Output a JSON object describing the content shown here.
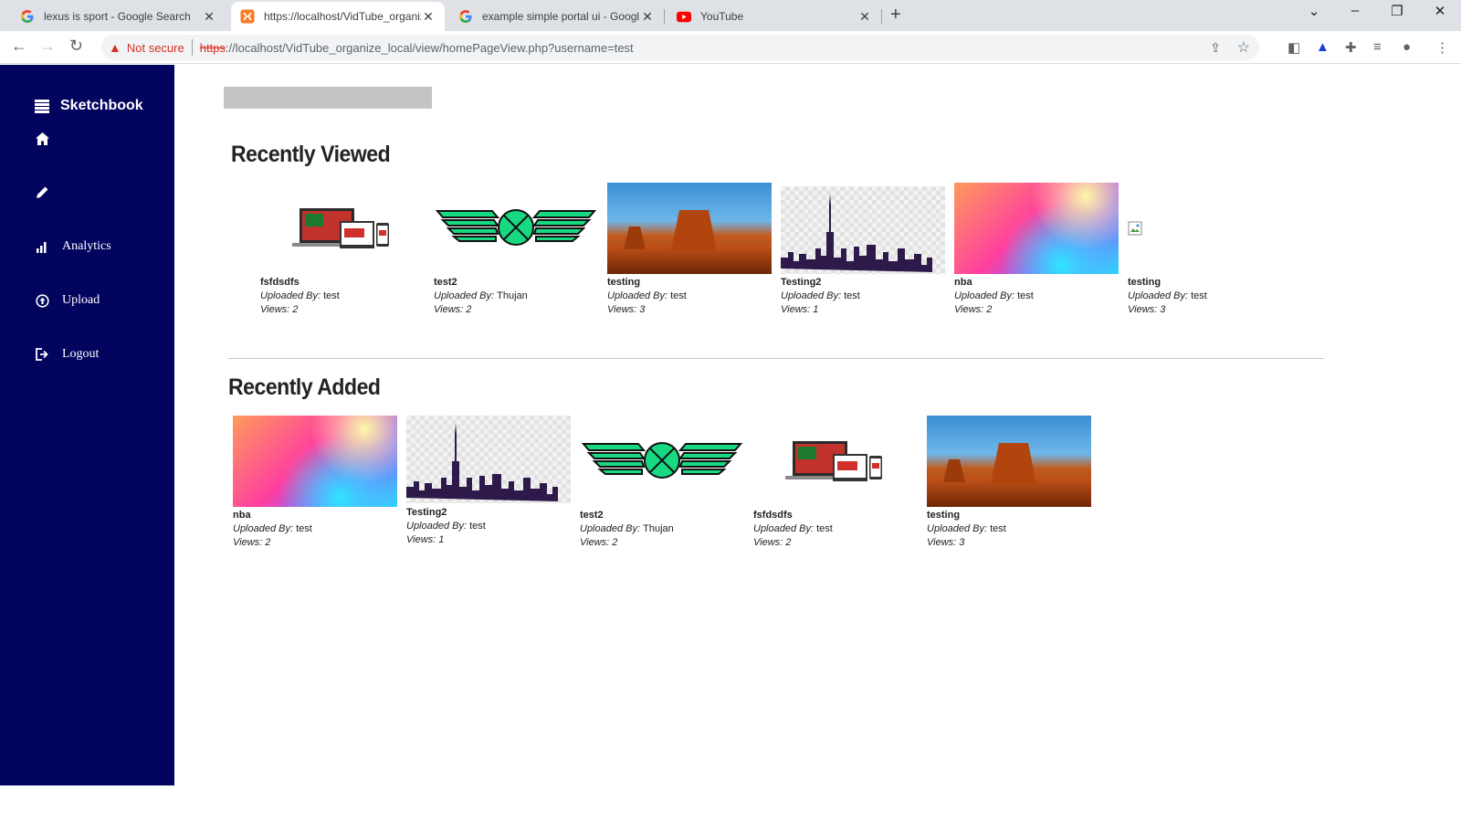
{
  "browser": {
    "tabs": [
      {
        "title": "lexus is sport - Google Search",
        "icon": "google-icon",
        "active": false
      },
      {
        "title": "https://localhost/VidTube_organiz",
        "icon": "xampp-icon",
        "active": true
      },
      {
        "title": "example simple portal ui - Googl",
        "icon": "google-icon",
        "active": false
      },
      {
        "title": "YouTube",
        "icon": "youtube-icon",
        "active": false
      }
    ],
    "security_label": "Not secure",
    "url_scheme": "https",
    "url_rest": "://localhost/VidTube_organize_local/view/homePageView.php?username=test"
  },
  "sidebar": {
    "brand": "Sketchbook",
    "items": [
      {
        "label": "",
        "icon": "home-icon"
      },
      {
        "label": "",
        "icon": "pencil-icon"
      },
      {
        "label": "Analytics",
        "icon": "chart-icon"
      },
      {
        "label": "Upload",
        "icon": "upload-icon"
      },
      {
        "label": "Logout",
        "icon": "logout-icon"
      }
    ]
  },
  "main": {
    "uploaded_by_label": "Uploaded By: ",
    "views_label": "Views: ",
    "recently_viewed": {
      "title": "Recently Viewed",
      "videos": [
        {
          "title": "fsfdsdfs",
          "uploader": "test",
          "views": "2",
          "thumb": "devices"
        },
        {
          "title": "test2",
          "uploader": "Thujan",
          "views": "2",
          "thumb": "wings-logo"
        },
        {
          "title": "testing",
          "uploader": "test",
          "views": "3",
          "thumb": "desert"
        },
        {
          "title": "Testing2",
          "uploader": "test",
          "views": "1",
          "thumb": "skyline"
        },
        {
          "title": "nba",
          "uploader": "test",
          "views": "2",
          "thumb": "gradient"
        },
        {
          "title": "testing",
          "uploader": "test",
          "views": "3",
          "thumb": "broken-image"
        }
      ]
    },
    "recently_added": {
      "title": "Recently Added",
      "videos": [
        {
          "title": "nba",
          "uploader": "test",
          "views": "2",
          "thumb": "gradient"
        },
        {
          "title": "Testing2",
          "uploader": "test",
          "views": "1",
          "thumb": "skyline"
        },
        {
          "title": "test2",
          "uploader": "Thujan",
          "views": "2",
          "thumb": "wings-logo"
        },
        {
          "title": "fsfdsdfs",
          "uploader": "test",
          "views": "2",
          "thumb": "devices"
        },
        {
          "title": "testing",
          "uploader": "test",
          "views": "3",
          "thumb": "desert"
        }
      ]
    }
  },
  "colors": {
    "sidebar_bg": "#03045e",
    "logo_green": "#17d982",
    "skyline_purple": "#2d1a4a"
  }
}
